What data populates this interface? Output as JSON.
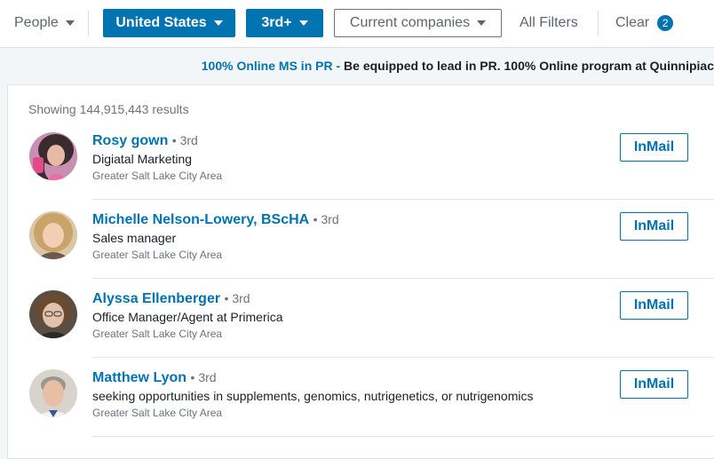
{
  "filters": {
    "people": "People",
    "location": "United States",
    "connection": "3rd+",
    "companies": "Current companies",
    "all_filters": "All Filters",
    "clear": "Clear",
    "clear_count": "2"
  },
  "ad": {
    "link": "100% Online MS in PR -",
    "text": " Be equipped to lead in PR. 100% Online program at Quinnipiac"
  },
  "results": {
    "count_text": "Showing 144,915,443 results",
    "action_label": "InMail",
    "items": [
      {
        "name": "Rosy gown",
        "degree": "• 3rd",
        "headline": "Digiatal Marketing",
        "location": "Greater Salt Lake City Area"
      },
      {
        "name": "Michelle Nelson-Lowery, BScHA",
        "degree": "• 3rd",
        "headline": "Sales manager",
        "location": "Greater Salt Lake City Area"
      },
      {
        "name": "Alyssa Ellenberger",
        "degree": "• 3rd",
        "headline": "Office Manager/Agent at Primerica",
        "location": "Greater Salt Lake City Area"
      },
      {
        "name": "Matthew Lyon",
        "degree": "• 3rd",
        "headline": "seeking opportunities in supplements, genomics, nutrigenetics, or nutrigenomics",
        "location": "Greater Salt Lake City Area"
      }
    ]
  },
  "colors": {
    "brand": "#0073b1",
    "muted": "#6b747c",
    "background": "#f3f6f8"
  },
  "icons": [
    "caret-down-icon"
  ]
}
